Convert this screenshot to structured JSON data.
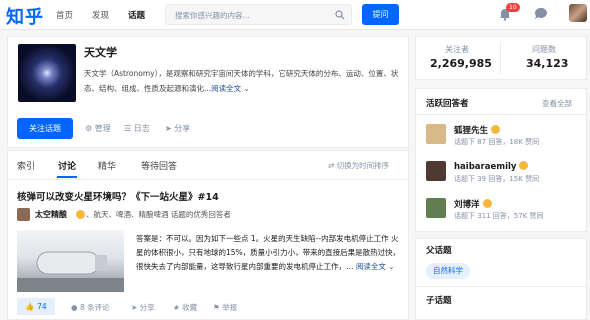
{
  "header": {
    "logo": "知乎",
    "nav": [
      "首页",
      "发现",
      "话题"
    ],
    "search_placeholder": "搜索你感兴趣的内容...",
    "ask_label": "提问",
    "notif_count": "10"
  },
  "topic": {
    "title": "天文学",
    "description": "天文学（Astronomy），是观察和研究宇宙间天体的学科，它研究天体的分布、运动、位置、状态、结构、组成、性质及起源和演化...",
    "read_more": "阅读全文",
    "follow_label": "关注话题",
    "manage": "管理",
    "log": "日志",
    "share": "分享"
  },
  "stats": {
    "followers_label": "关注者",
    "followers": "2,269,985",
    "questions_label": "问题数",
    "questions": "34,123"
  },
  "tabs": [
    "索引",
    "讨论",
    "精华",
    "等待回答"
  ],
  "sort_label": "切换为时间排序",
  "feed": {
    "question": "核弹可以改变火星环境吗？《下一站火星》#14",
    "author": "太空精酿",
    "author_tags": "、航天、啤酒、精酿啤酒 话题的优秀回答者",
    "answer": "答案是：不可以。因为如下一些点 1。火星的天生缺陷--内部发电机停止工作 火星的体积很小，只有地球的15%，质量小引力小，带来的直接后果是散热过快，很快失去了内部能量，这导致行星内部重要的发电机停止工作，…",
    "read_more": "阅读全文",
    "votes": "74",
    "comments": "8 条评论",
    "share": "分享",
    "favorite": "收藏",
    "report": "举报"
  },
  "sidebar": {
    "active_title": "活跃回答者",
    "view_all": "查看全部",
    "users": [
      {
        "name": "狐狸先生",
        "detail": "话题下 87 回答，18K 赞同"
      },
      {
        "name": "haibaraemily",
        "detail": "话题下 39 回答，15K 赞同"
      },
      {
        "name": "刘博洋",
        "detail": "话题下 311 回答，57K 赞同"
      }
    ],
    "parent_title": "父话题",
    "parent_topic": "自然科学",
    "child_title": "子话题"
  },
  "colors": {
    "brand": "#0066ff",
    "muted": "#8590a6"
  }
}
